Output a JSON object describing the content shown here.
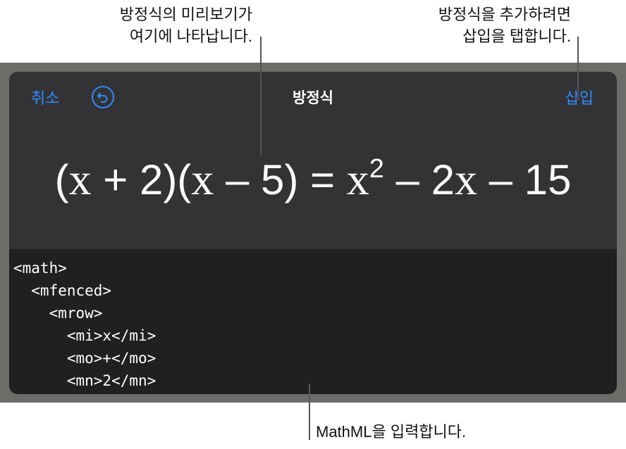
{
  "callouts": {
    "preview": {
      "line1": "방정식의 미리보기가",
      "line2": "여기에 나타납니다."
    },
    "insert": {
      "line1": "방정식을 추가하려면",
      "line2": "삽입을 탭합니다."
    },
    "mathml": {
      "text": "MathML을 입력합니다."
    }
  },
  "nav": {
    "cancel_label": "취소",
    "undo_icon": "undo-arrow-circle",
    "title": "방정식",
    "insert_label": "삽입"
  },
  "equation": {
    "p1": "(",
    "v1": "x",
    "p2": " + 2)(",
    "v2": "x",
    "p3": " – 5) = ",
    "v3": "x",
    "exp": "2",
    "p4": " – 2",
    "v4": "x",
    "p5": " – 15"
  },
  "code_lines": [
    "<math>",
    "  <mfenced>",
    "    <mrow>",
    "      <mi>x</mi>",
    "      <mo>+</mo>",
    "      <mn>2</mn>"
  ],
  "colors": {
    "accent": "#2d8cff",
    "panel": "#333335",
    "code_bg": "#202022",
    "frame": "#6c6d68"
  }
}
